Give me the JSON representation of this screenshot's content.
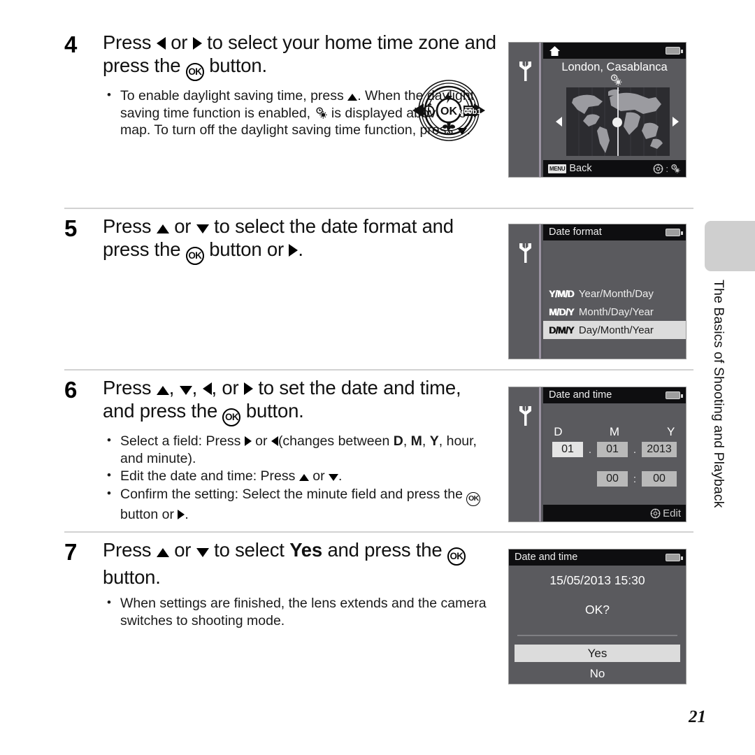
{
  "page": {
    "number": "21",
    "side_tab_label": "The Basics of Shooting and Playback"
  },
  "steps": [
    {
      "number": "4",
      "heading_parts": [
        "Press ",
        "◀",
        " or ",
        "▶",
        " to select your home time zone and press the ",
        "OK",
        " button."
      ],
      "heading_plain": "Press ◀ or ▶ to select your home time zone and press the OK button.",
      "bullets": [
        "To enable daylight saving time, press ▲. When the daylight saving time function is enabled, ☀ is displayed above the map. To turn off the daylight saving time function, press ▼."
      ]
    },
    {
      "number": "5",
      "heading_plain": "Press ▲ or ▼ to select the date format and press the OK button or ▶.",
      "bullets": []
    },
    {
      "number": "6",
      "heading_plain": "Press ▲, ▼, ◀, or ▶ to set the date and time, and press the OK button.",
      "bullets": [
        "Select a field: Press ▶ or ◀ (changes between D, M, Y, hour, and minute).",
        "Edit the date and time: Press ▲ or ▼.",
        "Confirm the setting: Select the minute field and press the OK button or ▶."
      ]
    },
    {
      "number": "7",
      "heading_plain": "Press ▲ or ▼ to select Yes and press the OK button.",
      "bullets": [
        "When settings are finished, the lens extends and the camera switches to shooting mode."
      ]
    }
  ],
  "multi_selector": {
    "center_label": "OK",
    "top_icon": "flash-icon",
    "left_icon": "self-timer-icon",
    "right_icon": "exposure-compensation-icon",
    "bottom_icon": "macro-icon",
    "outer_left_icon": "left-arrow-icon",
    "outer_right_icon": "right-arrow-icon"
  },
  "screens": {
    "home_time_zone": {
      "sidebar_icon": "wrench-icon",
      "title_icon": "home-icon",
      "battery_icon": "battery-icon",
      "city": "London, Casablanca",
      "dst_icon": "daylight-saving-icon",
      "left_arrow": "left-arrow-icon",
      "right_arrow": "right-arrow-icon",
      "bottom_left_chip": "MENU",
      "bottom_left_label": "Back",
      "bottom_right_label": ":",
      "bottom_right_icons": [
        "multi-selector-icon",
        "daylight-saving-icon"
      ]
    },
    "date_format": {
      "sidebar_icon": "wrench-icon",
      "title": "Date format",
      "battery_icon": "battery-icon",
      "options": [
        {
          "code": "Y/M/D",
          "label": "Year/Month/Day",
          "selected": false
        },
        {
          "code": "M/D/Y",
          "label": "Month/Day/Year",
          "selected": false
        },
        {
          "code": "D/M/Y",
          "label": "Day/Month/Year",
          "selected": true
        }
      ]
    },
    "date_and_time": {
      "sidebar_icon": "wrench-icon",
      "title": "Date and time",
      "battery_icon": "battery-icon",
      "labels": [
        "D",
        "M",
        "Y"
      ],
      "day": "01",
      "month": "01",
      "year": "2013",
      "date_separator": ".",
      "hour": "00",
      "minute": "00",
      "time_separator": ":",
      "footer_icon": "multi-selector-icon",
      "footer_label": "Edit"
    },
    "confirm": {
      "title": "Date and time",
      "battery_icon": "battery-icon",
      "datetime": "15/05/2013  15:30",
      "question": "OK?",
      "yes_label": "Yes",
      "no_label": "No"
    }
  },
  "colors": {
    "lcd_background": "#5a5a5e",
    "lcd_titlebar": "#0e0e10",
    "lcd_highlight": "#dcdcdc",
    "side_tab": "#cfcfcf",
    "rule": "#d2d2d2"
  }
}
